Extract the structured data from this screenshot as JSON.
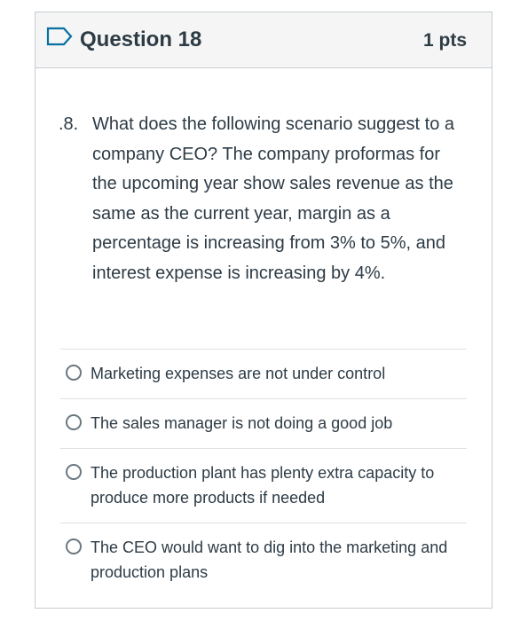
{
  "header": {
    "title": "Question 18",
    "points": "1 pts",
    "flag_icon": "flag-outline-icon",
    "flag_color": "#0770a3"
  },
  "question": {
    "number": ".8.",
    "text": "What does the following scenario suggest to a company CEO? The company proformas for the upcoming year show sales revenue as the same as the current year, margin as a percentage is increasing from 3% to 5%, and interest expense is increasing by 4%."
  },
  "answers": [
    {
      "label": "Marketing expenses are not under control"
    },
    {
      "label": "The sales manager is not doing a good job"
    },
    {
      "label": "The production plant has plenty extra capacity to produce more products if needed"
    },
    {
      "label": "The CEO would want to dig into the marketing and production plans"
    }
  ]
}
